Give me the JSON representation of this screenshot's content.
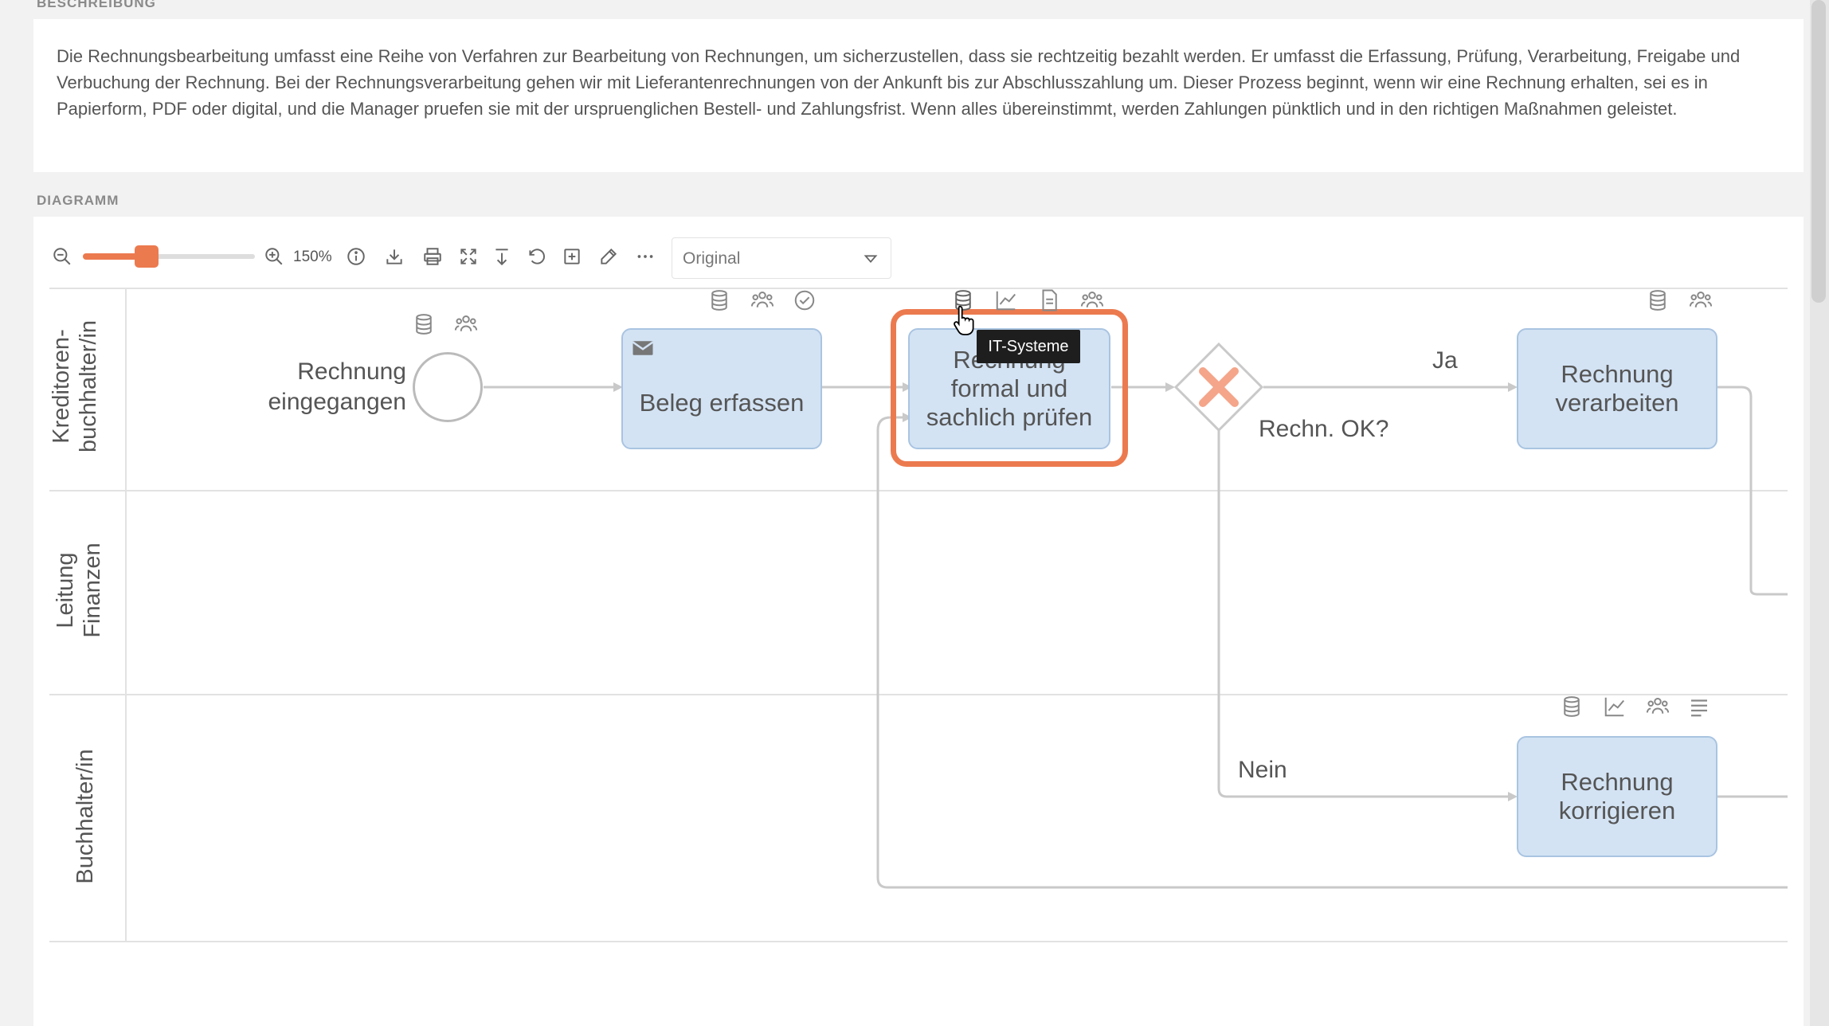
{
  "sections": {
    "description_label": "BESCHREIBUNG",
    "diagram_label": "DIAGRAMM"
  },
  "description": {
    "text": "Die Rechnungsbearbeitung umfasst eine Reihe von Verfahren zur Bearbeitung von Rechnungen, um sicherzustellen, dass sie rechtzeitig bezahlt werden. Er umfasst die Erfassung, Prüfung, Verarbeitung, Freigabe und Verbuchung der Rechnung. Bei der Rechnungsverarbeitung gehen wir mit Lieferantenrechnungen von der Ankunft bis zur Abschlusszahlung um. Dieser Prozess beginnt, wenn wir eine Rechnung erhalten, sei es in Papierform, PDF oder digital, und die Manager pruefen sie mit der urspruenglichen Bestell- und Zahlungsfrist. Wenn alles übereinstimmt, werden Zahlungen pünktlich und in den richtigen Maßnahmen geleistet."
  },
  "toolbar": {
    "zoom_label": "150%",
    "zoom_level_percent": 36,
    "view_select": {
      "value": "Original"
    },
    "icons": [
      "zoom-out-icon",
      "zoom-in-icon",
      "info-icon",
      "download-icon",
      "print-icon",
      "fit-icon",
      "export-icon",
      "undo-icon",
      "add-icon",
      "edit-icon",
      "more-icon"
    ]
  },
  "lanes": [
    {
      "label_line1": "Kreditoren-",
      "label_line2": "buchhalter/in"
    },
    {
      "label_line1": "Leitung",
      "label_line2": "Finanzen"
    },
    {
      "label_line1": "Buchhalter/in",
      "label_line2": ""
    }
  ],
  "diagram": {
    "start_event": {
      "line1": "Rechnung",
      "line2": "eingegangen"
    },
    "tasks": {
      "beleg": "Beleg erfassen",
      "pruefen_line1": "Rechnung",
      "pruefen_line2": "formal und",
      "pruefen_line3": "sachlich prüfen",
      "verarbeiten_line1": "Rechnung",
      "verarbeiten_line2": "verarbeiten",
      "korrigieren_line1": "Rechnung",
      "korrigieren_line2": "korrigieren"
    },
    "gateway": {
      "question": "Rechn. OK?",
      "yes": "Ja",
      "no": "Nein"
    },
    "tooltip": "IT-Systeme"
  },
  "colors": {
    "accent": "#ec7a4f",
    "task_fill": "#d3e3f4",
    "task_border": "#a9c4e1",
    "gateway_x": "#f4a58a"
  }
}
